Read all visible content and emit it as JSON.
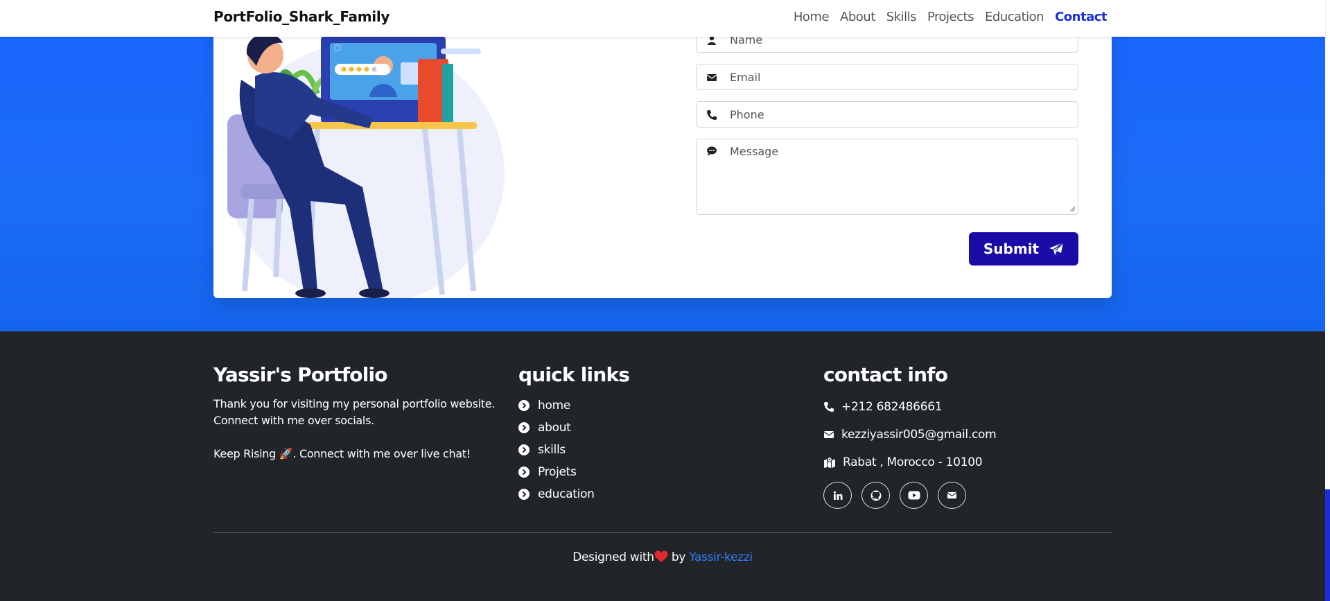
{
  "navbar": {
    "brand": "PortFolio_Shark_Family",
    "links": [
      {
        "label": "Home"
      },
      {
        "label": "About"
      },
      {
        "label": "Skills"
      },
      {
        "label": "Projects"
      },
      {
        "label": "Education"
      },
      {
        "label": "Contact"
      }
    ],
    "active": "Contact"
  },
  "contact_form": {
    "name_placeholder": "Name",
    "email_placeholder": "Email",
    "phone_placeholder": "Phone",
    "message_placeholder": "Message",
    "submit_label": "Submit"
  },
  "footer": {
    "about": {
      "title": "Yassir's Portfolio",
      "text1": "Thank you for visiting my personal portfolio website. Connect with me over socials.",
      "text2": "Keep Rising 🚀. Connect with me over live chat!"
    },
    "quick_links": {
      "title": "quick links",
      "items": [
        "home",
        "about",
        "skills",
        "Projets",
        "education"
      ]
    },
    "contact_info": {
      "title": "contact info",
      "phone": "+212 682486661",
      "email": "kezziyassir005@gmail.com",
      "address": "Rabat , Morocco - 10100"
    },
    "social_icons": [
      "linkedin-icon",
      "github-icon",
      "youtube-icon",
      "envelope-icon"
    ],
    "credit_prefix": "Designed with",
    "credit_by": "by",
    "credit_author": "Yassir-kezzi"
  },
  "colors": {
    "accent_blue": "#1a66ff",
    "submit_bg": "#1a0aa6",
    "footer_bg": "#212529",
    "link_blue": "#2f7cf6"
  }
}
